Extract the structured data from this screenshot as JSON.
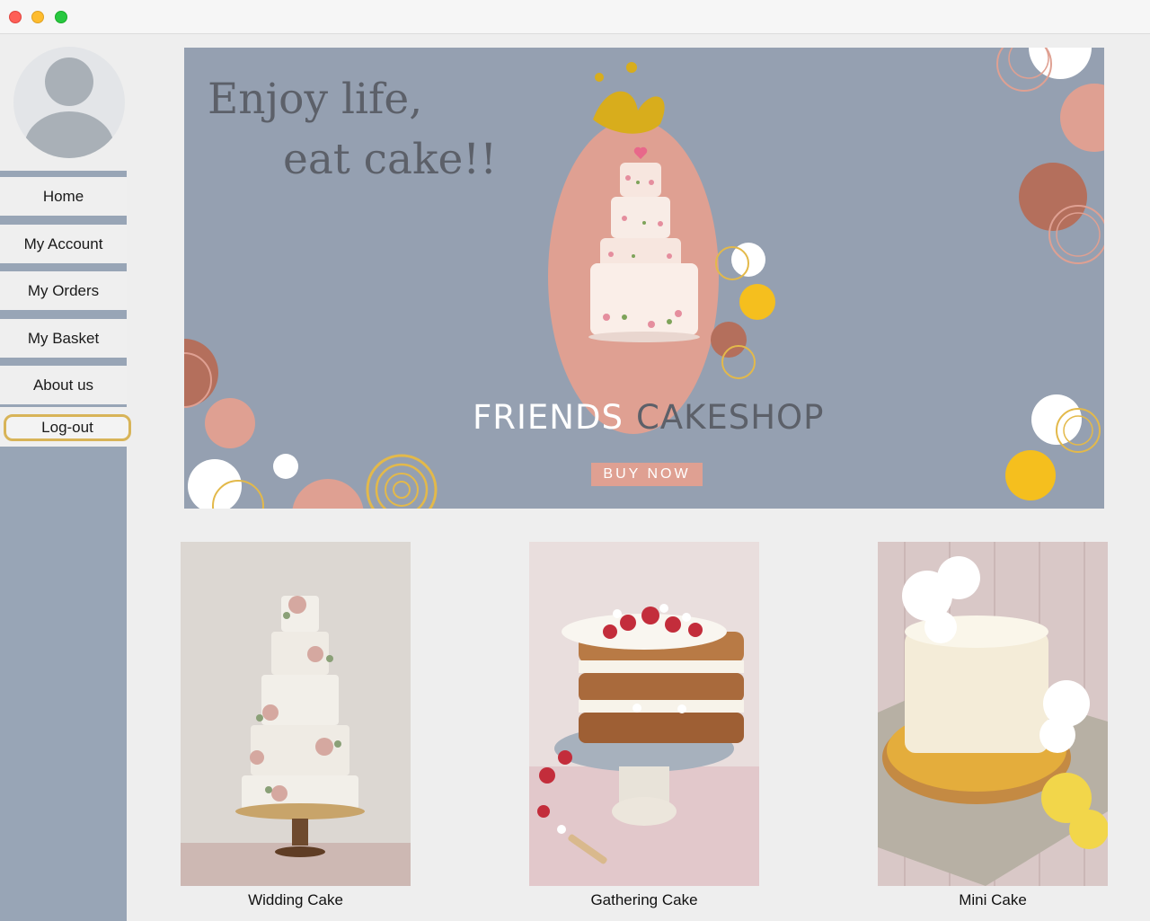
{
  "banner": {
    "tagline_line1": "Enjoy life,",
    "tagline_line2": "eat cake!!",
    "brand_word1": "FRIENDS",
    "brand_word2": "CAKESHOP",
    "cta_label": "BUY NOW"
  },
  "sidebar": {
    "items": [
      {
        "label": "Home"
      },
      {
        "label": "My Account"
      },
      {
        "label": "My Orders"
      },
      {
        "label": "My Basket"
      },
      {
        "label": "About us"
      }
    ],
    "logout_label": "Log-out"
  },
  "products": [
    {
      "name": "Widding Cake"
    },
    {
      "name": "Gathering Cake"
    },
    {
      "name": "Mini Cake"
    }
  ],
  "colors": {
    "sidebar": "#98a5b6",
    "banner_bg": "#95a0b1",
    "accent_pink": "#dfa092",
    "accent_yellow": "#f5bf1e",
    "accent_brown": "#b46f5c"
  }
}
